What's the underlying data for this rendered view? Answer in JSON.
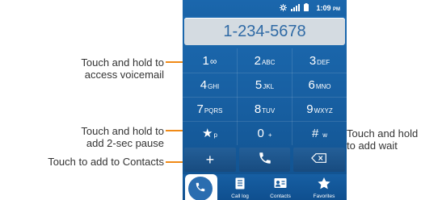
{
  "status_bar": {
    "time": "1:09",
    "ampm": "PM",
    "icons": [
      "settings-icon",
      "signal-icon",
      "battery-icon"
    ]
  },
  "dialer": {
    "number": "1-234-5678",
    "keys": [
      {
        "digit": "1",
        "letters": "∞"
      },
      {
        "digit": "2",
        "letters": "ABC"
      },
      {
        "digit": "3",
        "letters": "DEF"
      },
      {
        "digit": "4",
        "letters": "GHI"
      },
      {
        "digit": "5",
        "letters": "JKL"
      },
      {
        "digit": "6",
        "letters": "MNO"
      },
      {
        "digit": "7",
        "letters": "PQRS"
      },
      {
        "digit": "8",
        "letters": "TUV"
      },
      {
        "digit": "9",
        "letters": "WXYZ"
      },
      {
        "digit": "★",
        "letters": "p"
      },
      {
        "digit": "0",
        "letters": "+"
      },
      {
        "digit": "#",
        "letters": "w"
      }
    ],
    "actions": {
      "add_label": "+",
      "call_icon": "phone-icon",
      "delete_icon": "backspace-icon"
    }
  },
  "tabs": [
    {
      "label": "",
      "icon": "phone-icon",
      "active": true
    },
    {
      "label": "Call log",
      "icon": "call-log-icon",
      "active": false
    },
    {
      "label": "Contacts",
      "icon": "contacts-icon",
      "active": false
    },
    {
      "label": "Favorites",
      "icon": "star-icon",
      "active": false
    }
  ],
  "callouts": {
    "voicemail": {
      "line1": "Touch and hold to",
      "line2": "access voicemail"
    },
    "pause": {
      "line1": "Touch and hold to",
      "line2": "add 2-sec pause"
    },
    "contacts": {
      "line1": "Touch to add to Contacts"
    },
    "wait": {
      "line1": "Touch and hold",
      "line2": "to add wait"
    }
  },
  "colors": {
    "screen_blue": "#1c6bb2",
    "display_bg": "#d4dbe1",
    "number_text": "#2f6aa5",
    "leader_line": "#f08a16"
  }
}
